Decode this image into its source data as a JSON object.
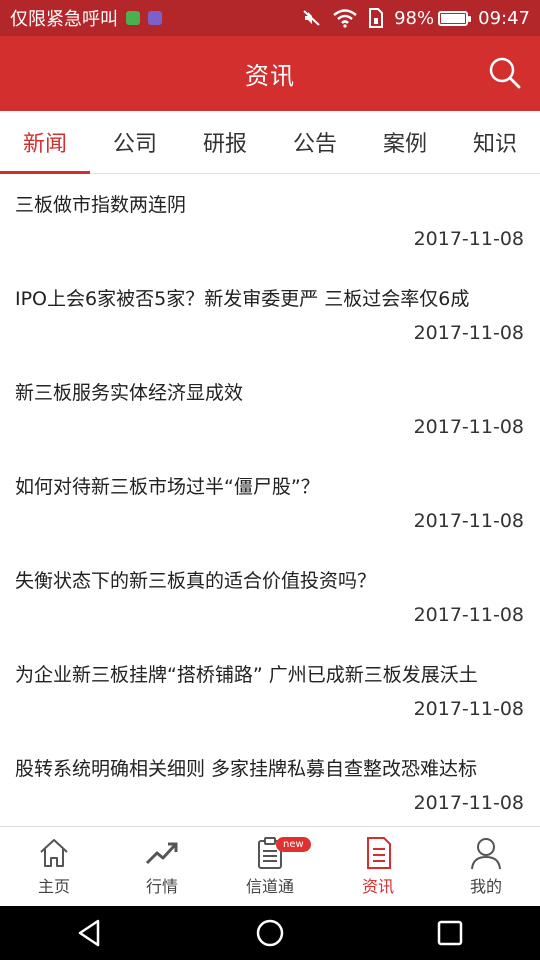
{
  "status_bar": {
    "carrier": "仅限紧急呼叫",
    "battery": "98%",
    "time": "09:47",
    "battery_level": 0.98,
    "icons": [
      "app-notification-icon",
      "gallery-notification-icon",
      "mute-icon",
      "wifi-icon",
      "sim-icon",
      "battery-icon"
    ]
  },
  "header": {
    "title": "资讯",
    "search_icon": "search-icon"
  },
  "tabs": [
    {
      "label": "新闻",
      "active": true
    },
    {
      "label": "公司",
      "active": false
    },
    {
      "label": "研报",
      "active": false
    },
    {
      "label": "公告",
      "active": false
    },
    {
      "label": "案例",
      "active": false
    },
    {
      "label": "知识",
      "active": false
    }
  ],
  "news": [
    {
      "title": "三板做市指数两连阴",
      "date": "2017-11-08"
    },
    {
      "title": "IPO上会6家被否5家？新发审委更严 三板过会率仅6成",
      "date": "2017-11-08"
    },
    {
      "title": "新三板服务实体经济显成效",
      "date": "2017-11-08"
    },
    {
      "title": "如何对待新三板市场过半“僵尸股”？",
      "date": "2017-11-08"
    },
    {
      "title": "失衡状态下的新三板真的适合价值投资吗？",
      "date": "2017-11-08"
    },
    {
      "title": "为企业新三板挂牌“搭桥铺路” 广州已成新三板发展沃土",
      "date": "2017-11-08"
    },
    {
      "title": "股转系统明确相关细则 多家挂牌私募自查整改恐难达标",
      "date": "2017-11-08"
    }
  ],
  "bottom_nav": [
    {
      "label": "主页",
      "icon": "home-icon",
      "active": false
    },
    {
      "label": "行情",
      "icon": "trend-icon",
      "active": false
    },
    {
      "label": "信道通",
      "icon": "clipboard-icon",
      "active": false,
      "badge": "new"
    },
    {
      "label": "资讯",
      "icon": "document-icon",
      "active": true
    },
    {
      "label": "我的",
      "icon": "user-icon",
      "active": false
    }
  ],
  "colors": {
    "status_bar": "#b3262a",
    "header": "#d32f2f",
    "accent": "#d32f2f",
    "badge": "#e03030"
  }
}
